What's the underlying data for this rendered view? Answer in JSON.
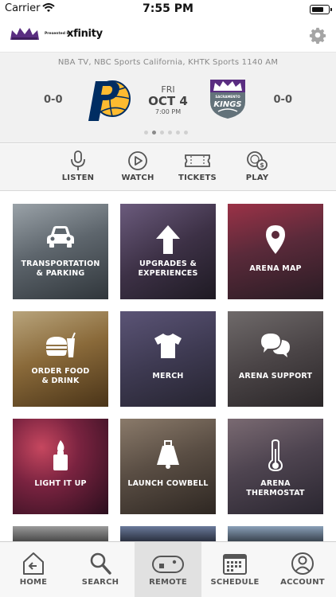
{
  "status_bar": {
    "carrier": "Carrier",
    "time": "7:55 PM"
  },
  "header": {
    "presented_by": "Presented by",
    "sponsor": "xfinity"
  },
  "game": {
    "broadcast": "NBA TV, NBC Sports California, KHTK Sports 1140 AM",
    "away_score": "0-0",
    "home_score": "0-0",
    "day": "FRI",
    "date": "OCT 4",
    "time": "7:00 PM",
    "home_logo_text_top": "SACRAMENTO",
    "home_logo_text": "KINGS",
    "pager_count": 6,
    "pager_active": 1
  },
  "quick_actions": [
    {
      "label": "LISTEN",
      "icon": "microphone-icon"
    },
    {
      "label": "WATCH",
      "icon": "play-icon"
    },
    {
      "label": "TICKETS",
      "icon": "ticket-icon"
    },
    {
      "label": "PLAY",
      "icon": "chips-icon"
    }
  ],
  "tiles": [
    {
      "label_1": "TRANSPORTATION",
      "label_2": "& PARKING",
      "icon": "car-icon"
    },
    {
      "label_1": "UPGRADES &",
      "label_2": "EXPERIENCES",
      "icon": "arrow-up-icon"
    },
    {
      "label_1": "ARENA MAP",
      "label_2": "",
      "icon": "map-pin-icon"
    },
    {
      "label_1": "ORDER FOOD",
      "label_2": "& DRINK",
      "icon": "food-icon"
    },
    {
      "label_1": "MERCH",
      "label_2": "",
      "icon": "jersey-icon"
    },
    {
      "label_1": "ARENA SUPPORT",
      "label_2": "",
      "icon": "chat-icon"
    },
    {
      "label_1": "LIGHT IT UP",
      "label_2": "",
      "icon": "lighter-icon"
    },
    {
      "label_1": "LAUNCH COWBELL",
      "label_2": "",
      "icon": "cowbell-icon"
    },
    {
      "label_1": "ARENA THERMOSTAT",
      "label_2": "",
      "icon": "thermometer-icon"
    }
  ],
  "bottom_nav": [
    {
      "label": "HOME",
      "icon": "home-icon"
    },
    {
      "label": "SEARCH",
      "icon": "search-icon"
    },
    {
      "label": "REMOTE",
      "icon": "gamepad-icon",
      "active": true
    },
    {
      "label": "SCHEDULE",
      "icon": "calendar-icon"
    },
    {
      "label": "ACCOUNT",
      "icon": "account-icon"
    }
  ],
  "colors": {
    "kings_purple": "#5a2d81",
    "pacers_navy": "#002d62",
    "pacers_gold": "#fdbb30",
    "scoreboard_bg": "#f1f1f1"
  }
}
